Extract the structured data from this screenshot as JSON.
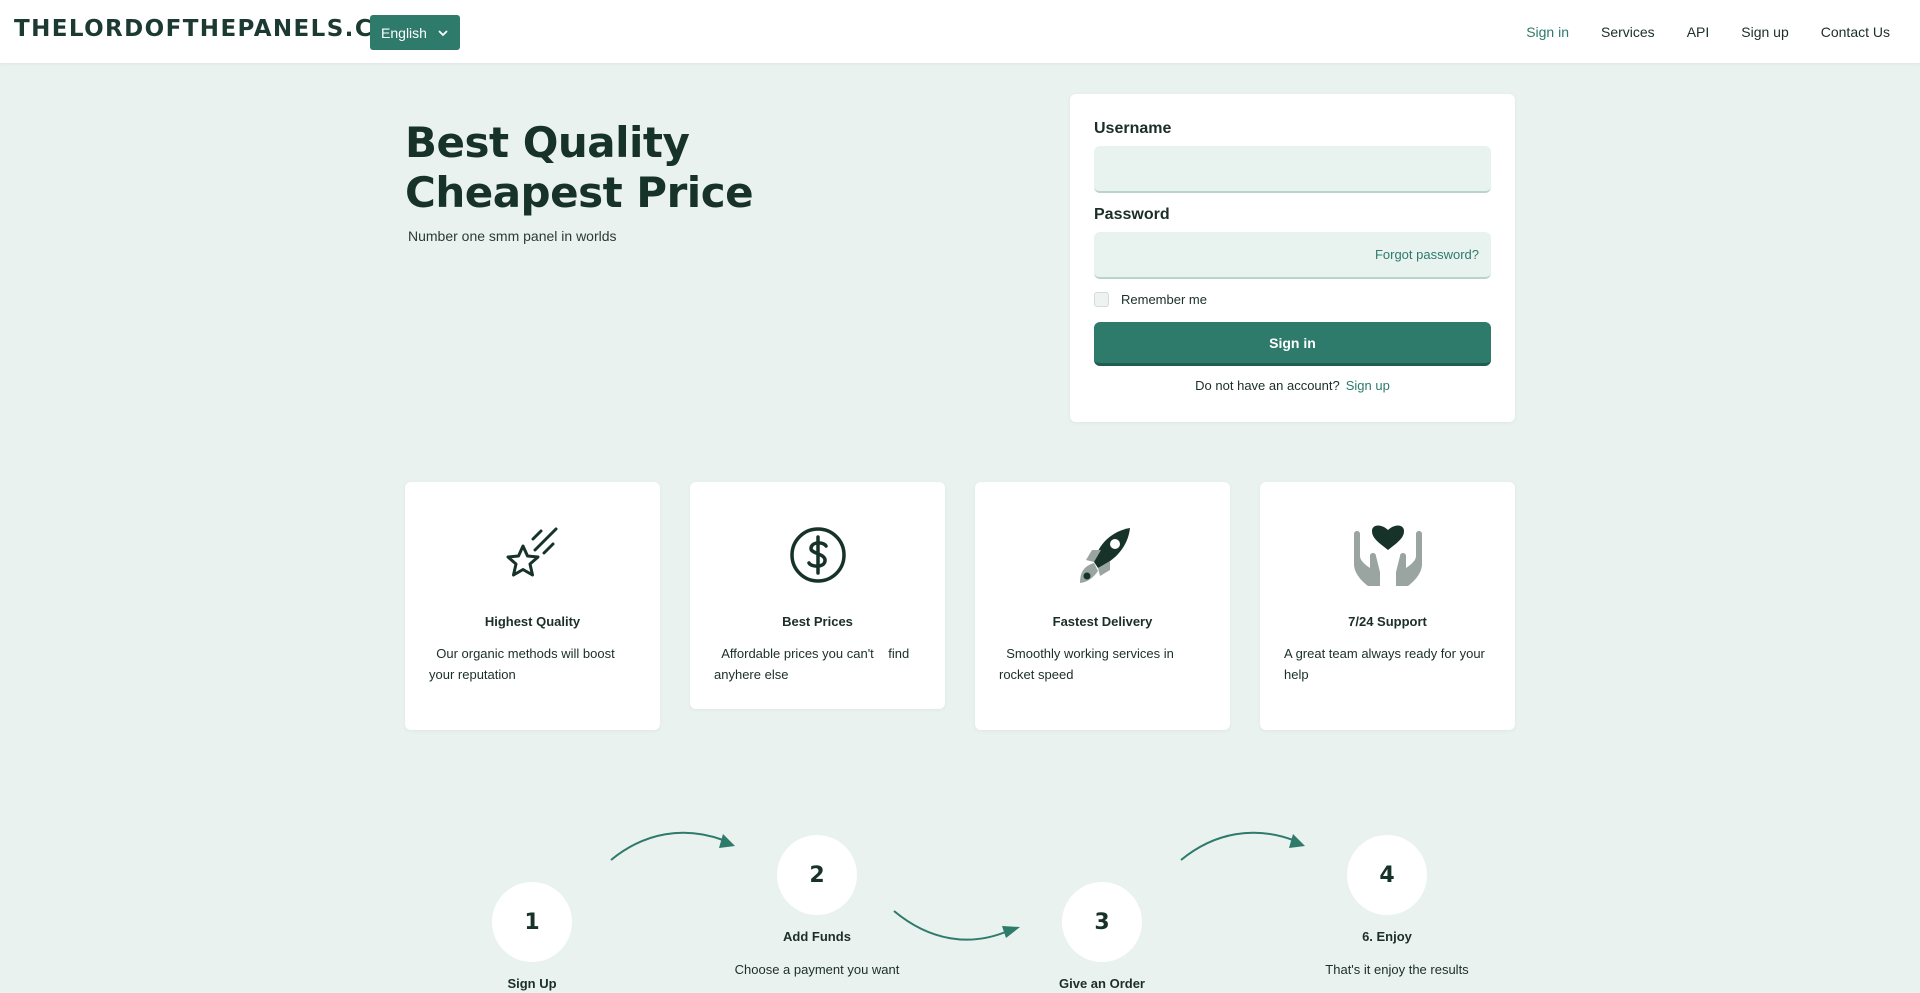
{
  "navbar": {
    "brand": "THELORDOFTHEPANELS.COM",
    "language": "English",
    "links": [
      "Sign in",
      "Services",
      "API",
      "Sign up",
      "Contact Us"
    ]
  },
  "hero": {
    "title": "Best Quality Cheapest Price",
    "subtitle": "Number one smm panel in worlds"
  },
  "login": {
    "username_label": "Username",
    "username_value": "",
    "password_label": "Password",
    "password_value": "",
    "forgot": "Forgot password?",
    "remember": "Remember me",
    "submit": "Sign in",
    "no_account": "Do not have an account?",
    "signup": "Sign up"
  },
  "features": [
    {
      "icon": "shooting-star-icon",
      "title": "Highest Quality",
      "desc": "  Our organic methods will boost your reputation"
    },
    {
      "icon": "dollar-circle-icon",
      "title": "Best Prices",
      "desc": "  Affordable prices you can't    find anyhere else"
    },
    {
      "icon": "rocket-icon",
      "title": "Fastest Delivery",
      "desc": "  Smoothly working services in rocket speed"
    },
    {
      "icon": "heart-hands-icon",
      "title": "7/24 Support",
      "desc": "A great team always ready for your help"
    }
  ],
  "steps": [
    {
      "number": "1",
      "title": "Sign Up",
      "desc": ""
    },
    {
      "number": "2",
      "title": "Add Funds",
      "desc": "Choose a payment you want"
    },
    {
      "number": "3",
      "title": "Give an Order",
      "desc": ""
    },
    {
      "number": "4",
      "title": "6. Enjoy",
      "desc": "That's it enjoy the results"
    }
  ],
  "colors": {
    "accent": "#2e7a6b",
    "background": "#eaf2ef",
    "heading": "#163229"
  }
}
